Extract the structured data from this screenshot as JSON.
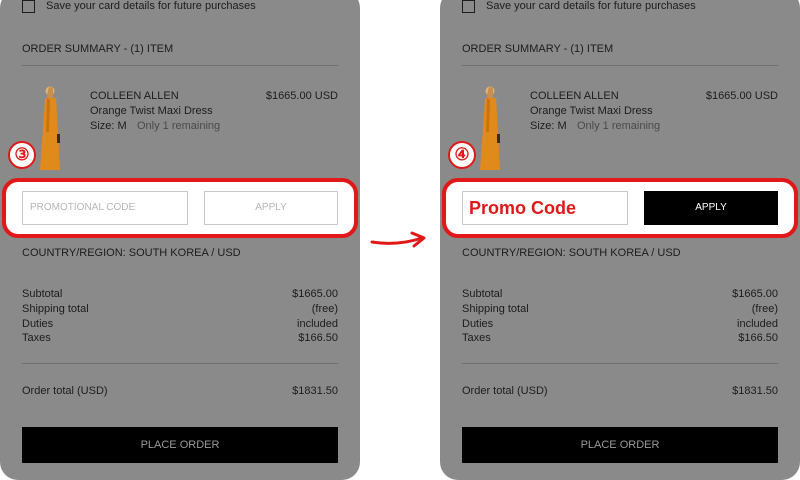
{
  "colors": {
    "overlay_gray": "#8a8a8a",
    "highlight_red": "#e01818",
    "button_black": "#000000"
  },
  "left": {
    "step_number": "③",
    "save_card_label": "Save your card details for future purchases",
    "order_summary_title": "ORDER SUMMARY - (1) ITEM",
    "item": {
      "brand": "COLLEEN ALLEN",
      "name": "Orange Twist Maxi Dress",
      "size": "Size: M",
      "stock": "Only 1 remaining",
      "price": "$1665.00 USD"
    },
    "promo_placeholder": "PROMOTIONAL CODE",
    "apply_label": "APPLY",
    "country": "COUNTRY/REGION: SOUTH KOREA / USD",
    "totals": [
      {
        "label": "Subtotal",
        "value": "$1665.00"
      },
      {
        "label": "Shipping total",
        "value": "(free)"
      },
      {
        "label": "Duties",
        "value": "included"
      },
      {
        "label": "Taxes",
        "value": "$166.50"
      }
    ],
    "order_total_label": "Order total (USD)",
    "order_total_value": "$1831.50",
    "place_order_label": "PLACE ORDER"
  },
  "right": {
    "step_number": "④",
    "save_card_label": "Save your card details for future purchases",
    "order_summary_title": "ORDER SUMMARY - (1) ITEM",
    "item": {
      "brand": "COLLEEN ALLEN",
      "name": "Orange Twist Maxi Dress",
      "size": "Size: M",
      "stock": "Only 1 remaining",
      "price": "$1665.00 USD"
    },
    "promo_value": "Promo Code",
    "apply_label": "APPLY",
    "country": "COUNTRY/REGION: SOUTH KOREA / USD",
    "totals": [
      {
        "label": "Subtotal",
        "value": "$1665.00"
      },
      {
        "label": "Shipping total",
        "value": "(free)"
      },
      {
        "label": "Duties",
        "value": "included"
      },
      {
        "label": "Taxes",
        "value": "$166.50"
      }
    ],
    "order_total_label": "Order total (USD)",
    "order_total_value": "$1831.50",
    "place_order_label": "PLACE ORDER"
  }
}
